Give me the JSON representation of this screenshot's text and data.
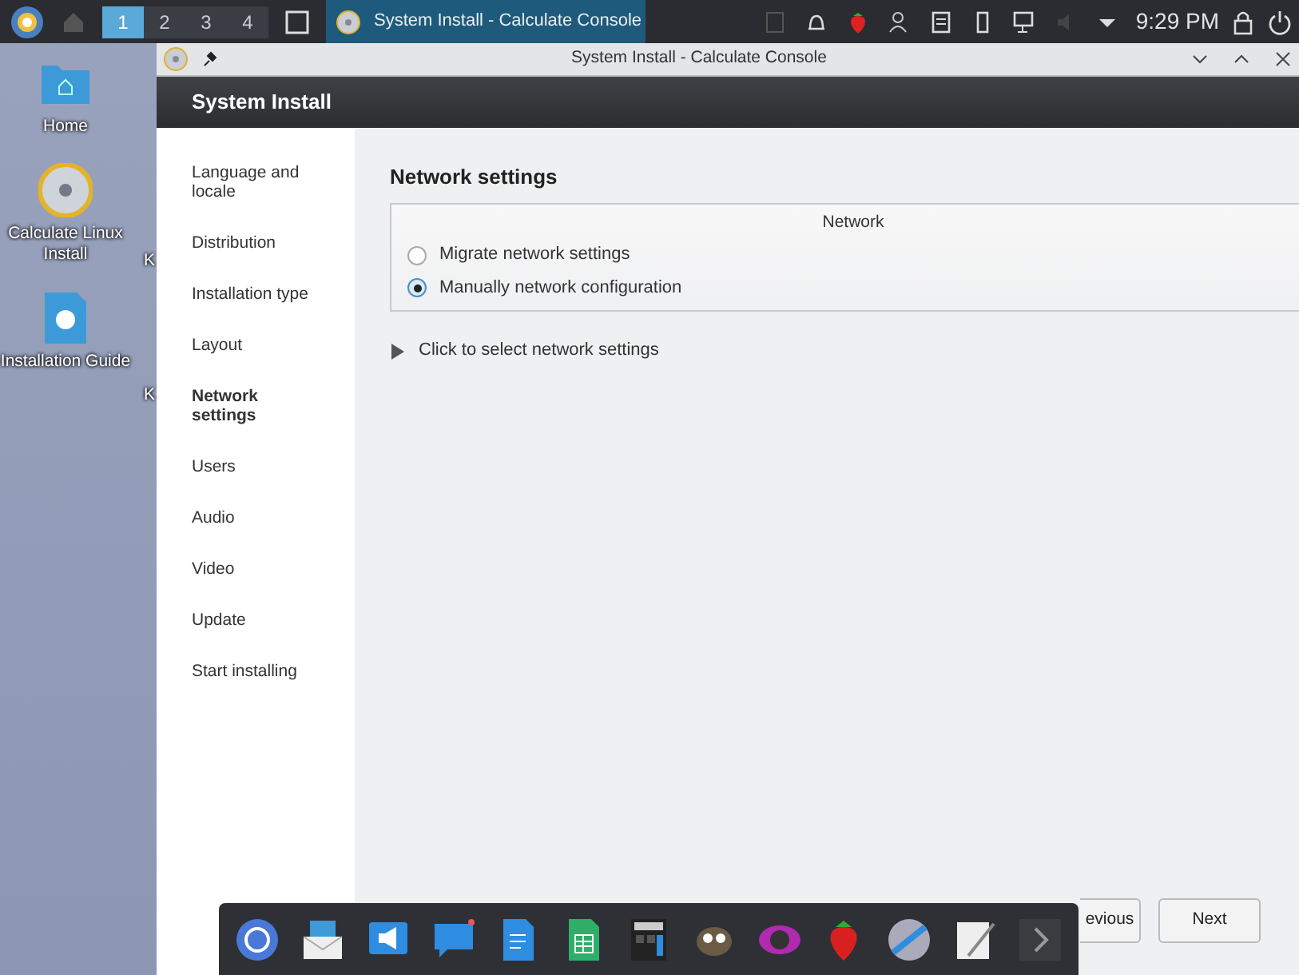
{
  "top_panel": {
    "desktops": [
      {
        "label": "1",
        "selected": true
      },
      {
        "label": "2",
        "selected": false
      },
      {
        "label": "3",
        "selected": false
      },
      {
        "label": "4",
        "selected": false
      }
    ],
    "task": {
      "title": "System Install - Calculate Console",
      "selected": true
    },
    "clock": "9:29 PM"
  },
  "desktop_icons": [
    {
      "label": "Home",
      "kind": "folder"
    },
    {
      "label": "Calculate Linux Install",
      "kind": "disc"
    },
    {
      "label": "Installation Guide",
      "kind": "document"
    }
  ],
  "hidden_labels": [
    "K",
    "K"
  ],
  "window": {
    "title": "System Install - Calculate Console",
    "header": "System Install",
    "sidebar": {
      "items": [
        {
          "label": "Language and locale",
          "selected": false
        },
        {
          "label": "Distribution",
          "selected": false
        },
        {
          "label": "Installation type",
          "selected": false
        },
        {
          "label": "Layout",
          "selected": false
        },
        {
          "label": "Network settings",
          "selected": true
        },
        {
          "label": "Users",
          "selected": false
        },
        {
          "label": "Audio",
          "selected": false
        },
        {
          "label": "Video",
          "selected": false
        },
        {
          "label": "Update",
          "selected": false
        },
        {
          "label": "Start installing",
          "selected": false
        }
      ]
    },
    "content": {
      "heading": "Network settings",
      "group": {
        "title": "Network",
        "options": [
          {
            "label": "Migrate network settings",
            "selected": false
          },
          {
            "label": "Manually network configuration",
            "selected": true
          }
        ]
      },
      "expander": {
        "label": "Click to select network settings",
        "expanded": false
      }
    },
    "buttons": [
      "evious",
      "Next"
    ]
  }
}
